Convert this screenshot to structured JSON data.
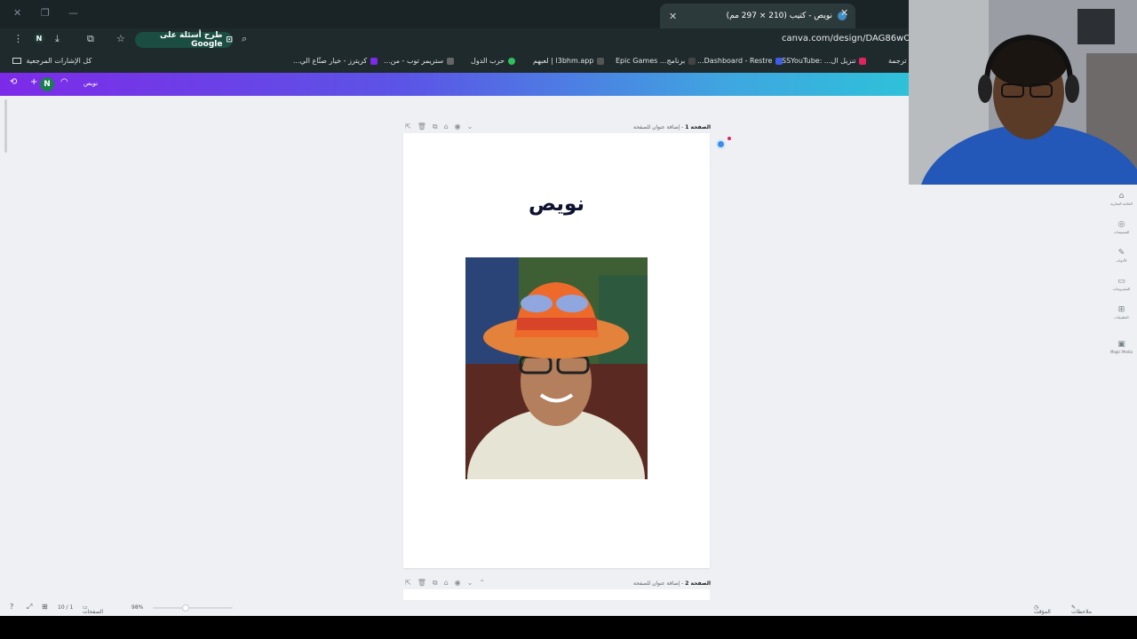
{
  "browser": {
    "tab_title": "نويص - كتيب (210 × 297 مم)",
    "url": "canva.com/design/DAG86wOV",
    "google_pill": "طرح أسئلة على Google",
    "account_initial": "N"
  },
  "bookmarks": {
    "all_label": "كل الإشارات المرجعية",
    "items": [
      "ترجمة",
      "تنزيل ال... :SSYouTube",
      "Dashboard - Restre...",
      "برنامج... Epic Games",
      "l3bhm.app | لعبهم",
      "حرب الدول",
      "ستريمر توب - من...",
      "كريترز - خيار صنّاع الي..."
    ]
  },
  "canva": {
    "doc_name": "نويص",
    "user_initial": "N"
  },
  "page1": {
    "label": "الصفحة 1",
    "add_title": "- إضافة عنوان للصفحة",
    "heading": "نويص"
  },
  "page2": {
    "label": "الصفحة 2",
    "add_title": "- إضافة عنوان للصفحة"
  },
  "rail": [
    {
      "label": "العلامة التجارية",
      "icon": "brand-icon"
    },
    {
      "label": "التصميمات",
      "icon": "design-icon"
    },
    {
      "label": "الأدوات",
      "icon": "tools-icon"
    },
    {
      "label": "المشروعات",
      "icon": "folder-icon"
    },
    {
      "label": "التطبيقات",
      "icon": "apps-icon"
    },
    {
      "label": "Magic Media",
      "icon": "magic-media-icon"
    }
  ],
  "footer": {
    "notes": "ملاحظات",
    "timer": "المؤقت",
    "zoom": "98%",
    "pages": "الصفحات",
    "page_count": "10 / 1"
  }
}
